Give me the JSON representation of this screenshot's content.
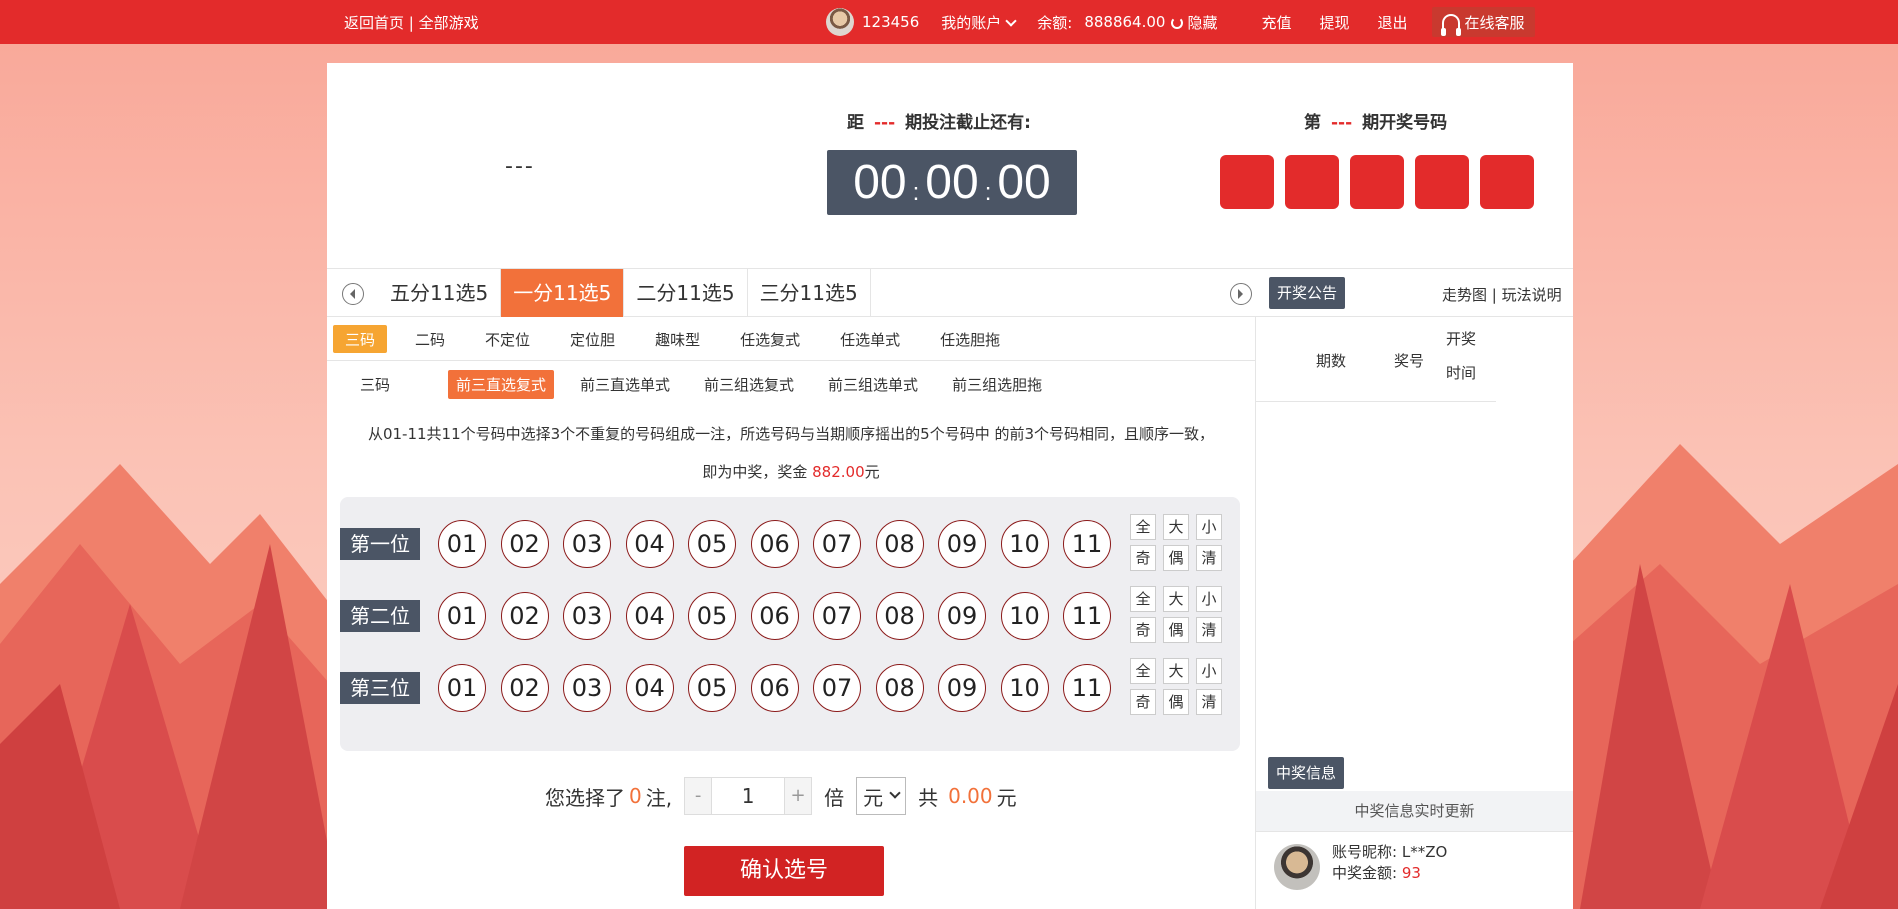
{
  "topbar": {
    "home_link": "返回首页",
    "sep": "|",
    "games_link": "全部游戏",
    "username": "123456",
    "account_menu": "我的账户",
    "balance_label": "余额:",
    "balance_value": "888864.00",
    "hide_label": "隐藏",
    "recharge": "充值",
    "withdraw": "提现",
    "logout": "退出",
    "service": "在线客服"
  },
  "header": {
    "issue_placeholder": "---",
    "countdown_prefix": "距",
    "countdown_issue": "---",
    "countdown_suffix": "期投注截止还有:",
    "hours": "00",
    "minutes": "00",
    "seconds": "00",
    "colon": ":",
    "draw_prefix": "第",
    "draw_issue": "---",
    "draw_suffix": "期开奖号码"
  },
  "lottery_tabs": [
    "五分11选5",
    "一分11选5",
    "二分11选5",
    "三分11选5"
  ],
  "lottery_tab_active": 1,
  "notice_button": "开奖公告",
  "trend_link": "走势图",
  "rules_link": "玩法说明",
  "categories": [
    "三码",
    "二码",
    "不定位",
    "定位胆",
    "趣味型",
    "任选复式",
    "任选单式",
    "任选胆拖"
  ],
  "category_active": 0,
  "sub_label": "三码",
  "subtypes": [
    "前三直选复式",
    "前三直选单式",
    "前三组选复式",
    "前三组选单式",
    "前三组选胆拖"
  ],
  "subtype_active": 0,
  "description": {
    "line1": "从01-11共11个号码中选择3个不重复的号码组成一注，所选号码与当期顺序摇出的5个号码中 的前3个号码相同，且顺序一致，",
    "line2_prefix": "即为中奖，奖金 ",
    "prize": "882.00",
    "line2_suffix": "元"
  },
  "picker": {
    "rows": [
      "第一位",
      "第二位",
      "第三位"
    ],
    "numbers": [
      "01",
      "02",
      "03",
      "04",
      "05",
      "06",
      "07",
      "08",
      "09",
      "10",
      "11"
    ],
    "quick": [
      "全",
      "大",
      "小",
      "奇",
      "偶",
      "清"
    ]
  },
  "bet": {
    "selected_prefix": "您选择了",
    "selected_count": "0",
    "selected_suffix": "注,",
    "minus": "-",
    "multiplier": "1",
    "plus": "+",
    "times_label": "倍",
    "unit": "元",
    "total_prefix": "共",
    "total_value": "0.00",
    "total_suffix": "元"
  },
  "confirm_button": "确认选号",
  "draw_table": {
    "col_issue": "期数",
    "col_number": "奖号",
    "col_time": "开奖时间"
  },
  "win_info": {
    "title": "中奖信息",
    "realtime": "中奖信息实时更新",
    "nickname_label": "账号昵称:",
    "nickname": "L**ZO",
    "amount_label": "中奖金额:",
    "amount": "93"
  },
  "colors": {
    "brand_red": "#e32b2b",
    "active_orange": "#f2713a",
    "category_orange": "#f6a532",
    "dark_slate": "#4b5565"
  }
}
